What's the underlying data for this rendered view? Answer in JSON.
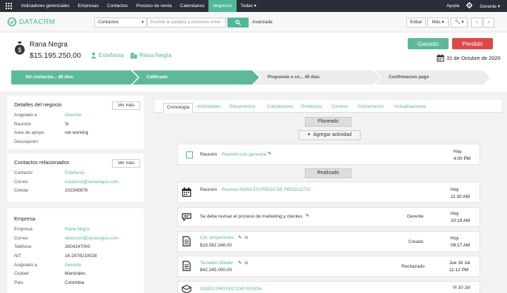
{
  "nav": {
    "items": [
      "Indicadores gerenciales",
      "Empresas",
      "Contactos",
      "Proceso de venta",
      "Calendarios",
      "Negocios",
      "Todas ▾"
    ],
    "active": "Negocios",
    "help": "Ayuda",
    "user": "Gerente"
  },
  "header": {
    "logo": "DATACRM",
    "module_select": "Contactos",
    "search_placeholder": "Escribe la palabra y presiona enter",
    "advanced": "Avanzada",
    "edit": "Editar",
    "more": "Más"
  },
  "deal": {
    "name": "Rana Negra",
    "amount": "$15.195.250,00",
    "contact": "Estefanía",
    "company": "Rana Negra",
    "won": "Ganado",
    "lost": "Perdido",
    "close_date": "31 de Octubre de 2020"
  },
  "pipeline": [
    {
      "label": "Sin contactar... 48  días",
      "state": "done"
    },
    {
      "label": "Calificado",
      "state": "done"
    },
    {
      "label": "Propuesta o co... 49  días",
      "state": "todo"
    },
    {
      "label": "Confirmacion pago",
      "state": "todo"
    }
  ],
  "details": {
    "title": "Detalles del negocio",
    "more": "Ver más",
    "rows": [
      {
        "k": "Asignado a",
        "v": "Gerente"
      },
      {
        "k": "Reunión",
        "v": "Si"
      },
      {
        "k": "Area de apoyo",
        "v": "net working"
      },
      {
        "k": "Descripción",
        "v": ""
      }
    ]
  },
  "contacts": {
    "title": "Contactos relacionados",
    "more": "Ver más",
    "rows": [
      {
        "k": "Contacto",
        "v": "Estefanía"
      },
      {
        "k": "Correo",
        "v": "creativos@rananegra.com"
      },
      {
        "k": "Celular",
        "v": "102345678"
      }
    ]
  },
  "company": {
    "title": "Empresa",
    "rows": [
      {
        "k": "Empresa",
        "v": "Rana Negra"
      },
      {
        "k": "Correo",
        "v": "direccion@rananegra.com"
      },
      {
        "k": "Teléfono",
        "v": "3004147000"
      },
      {
        "k": "NIT",
        "v": "16-2878219028"
      },
      {
        "k": "Asignado a",
        "v": "Gerente"
      },
      {
        "k": "Ciudad",
        "v": "Manizales"
      },
      {
        "k": "País",
        "v": "Colombia"
      }
    ]
  },
  "tabs": [
    "Cronología",
    "Actividades",
    "Documentos",
    "Cotizaciones",
    "Productos",
    "Correos",
    "Comentarios",
    "Actualizaciones"
  ],
  "timeline": {
    "planned": "Planeado",
    "add_activity": "Agregar actividad",
    "done": "Realizado",
    "items": [
      {
        "type": "Reunión",
        "title": "Reunión con gerencia",
        "status": "",
        "when1": "Hoy",
        "when2": "4:00 PM"
      },
      {
        "type": "Reunión",
        "title": "Reunión PARA ENTREGA DE PRODUCTO",
        "status": "",
        "when1": "Hoy",
        "when2": "11:30 AM"
      },
      {
        "type": "",
        "title": "Se debe revisar el proceso de marketing y clientes",
        "status": "Gerente",
        "when1": "Hoy",
        "when2": "10:19 AM"
      },
      {
        "type": "",
        "title": "Cot. proyectores",
        "sub": "$18.082.348,00",
        "status": "Creado",
        "when1": "Hoy",
        "when2": "09:17 AM"
      },
      {
        "type": "",
        "title": "Teclados Master",
        "sub": "$42.245.000,00",
        "status": "Rechazado",
        "when1": "Jue 16 Jul",
        "when2": "11:12 PM"
      },
      {
        "type": "",
        "title": "VIDEO PROYECTOR EPSON",
        "status": "",
        "when1": "Vi 10 Jul",
        "when2": ""
      }
    ]
  }
}
